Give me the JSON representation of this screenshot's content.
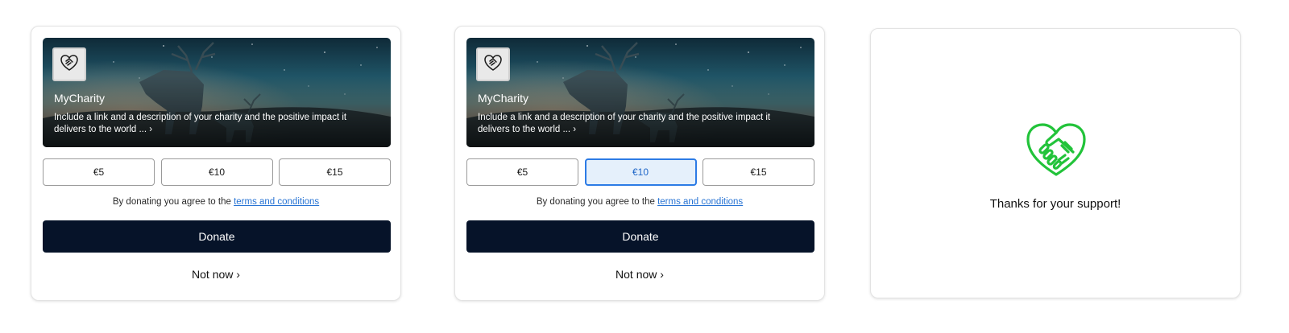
{
  "cards": [
    {
      "charity": {
        "name": "MyCharity",
        "description": "Include a link and a description of your charity and the positive impact it delivers to the world ... ›",
        "logo_icon": "handshake-heart-icon"
      },
      "amounts": [
        "€5",
        "€10",
        "€15"
      ],
      "selected_amount": null,
      "terms_prefix": "By donating you agree to the ",
      "terms_link": "terms and conditions",
      "donate_label": "Donate",
      "not_now_label": "Not now ›"
    },
    {
      "charity": {
        "name": "MyCharity",
        "description": "Include a link and a description of your charity and the positive impact it delivers to the world ... ›",
        "logo_icon": "handshake-heart-icon"
      },
      "amounts": [
        "€5",
        "€10",
        "€15"
      ],
      "selected_amount": "€10",
      "terms_prefix": "By donating you agree to the ",
      "terms_link": "terms and conditions",
      "donate_label": "Donate",
      "not_now_label": "Not now ›"
    }
  ],
  "thanks": {
    "icon": "handshake-heart-icon",
    "icon_color": "#22c33a",
    "message": "Thanks for your support!"
  },
  "colors": {
    "donate_button": "#061329",
    "link": "#2874d4",
    "selected_border": "#2c7be5",
    "selected_fill": "#e5f0fb"
  }
}
